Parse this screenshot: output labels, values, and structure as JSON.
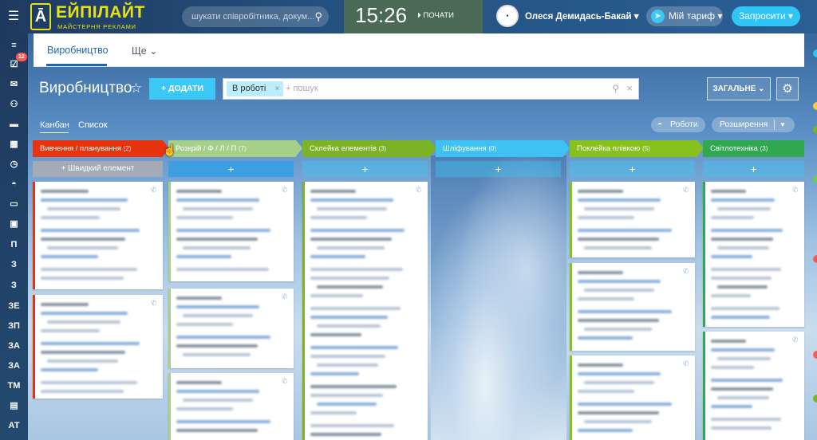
{
  "header": {
    "logo_mark": "Ā",
    "logo_name": "ЕЙПІЛАЙТ",
    "logo_sub": "МАЙСТЕРНЯ РЕКЛАМИ",
    "search_placeholder": "шукати співробітника, докум...",
    "time": "15:26",
    "start_label": "ПОЧАТИ",
    "user_name": "Олеся Демидась-Бакай",
    "tariff_label": "Мій тариф",
    "invite_label": "Запросити"
  },
  "sidebar": {
    "tasks_badge": "12",
    "letters": [
      "П",
      "З",
      "З",
      "ЗЕ",
      "ЗП",
      "ЗА",
      "ЗА",
      "ТМ",
      "АТ"
    ]
  },
  "tabs": {
    "active": "Виробництво",
    "more": "Ще"
  },
  "toolbar": {
    "title": "Виробництво",
    "add_label": "ДОДАТИ",
    "filter_chip": "В роботі",
    "filter_placeholder": "+ пошук",
    "general_label": "ЗАГАЛЬНЕ"
  },
  "view": {
    "kanban": "Канбан",
    "list": "Список",
    "robots": "Роботи",
    "extensions": "Розширення"
  },
  "columns": [
    {
      "title": "Вивчення / планування",
      "count": "(2)",
      "color": "#e8330f"
    },
    {
      "title": "Розкрій / Ф / Л / П",
      "count": "(7)",
      "color": "#a6d08a"
    },
    {
      "title": "Склейка елементів",
      "count": "(3)",
      "color": "#7bb324"
    },
    {
      "title": "Шліфування",
      "count": "(0)",
      "color": "#3dc2f3"
    },
    {
      "title": "Поклейка плівкою",
      "count": "(5)",
      "color": "#86c11c"
    },
    {
      "title": "Світлотехніка",
      "count": "(3)",
      "color": "#2fa84f"
    }
  ],
  "quick_add_label": "+ Швидкий елемент"
}
